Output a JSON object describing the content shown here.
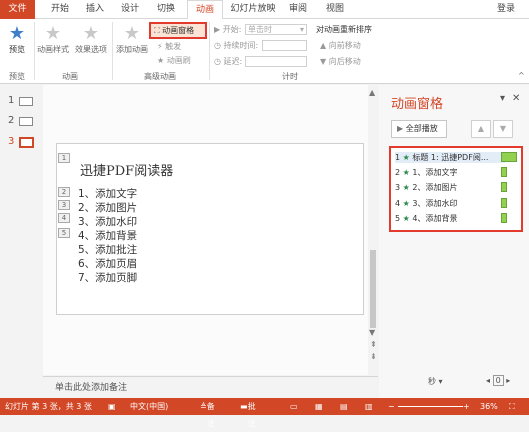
{
  "tabs": [
    {
      "label": "文件"
    },
    {
      "label": "开始"
    },
    {
      "label": "插入"
    },
    {
      "label": "设计"
    },
    {
      "label": "切换"
    },
    {
      "label": "动画"
    },
    {
      "label": "幻灯片放映"
    },
    {
      "label": "审阅"
    },
    {
      "label": "视图"
    }
  ],
  "login": "登录",
  "ribbon": {
    "preview": "预览",
    "preview_group": "预览",
    "animation_styles": "动画样式",
    "effect_options": "效果选项",
    "animation_group": "动画",
    "add_animation": "添加动画",
    "animation_pane": "动画窗格",
    "trigger": "触发",
    "animation_painter": "动画刷",
    "advanced_group": "高级动画",
    "start_label": "开始:",
    "start_value": "单击时",
    "duration_label": "持续时间:",
    "delay_label": "延迟:",
    "timing_group": "计时",
    "reorder": "对动画重新排序",
    "move_earlier": "向前移动",
    "move_later": "向后移动"
  },
  "thumbs": [
    "1",
    "2",
    "3"
  ],
  "slide": {
    "title": "迅捷PDF阅读器",
    "tags": [
      "1",
      "2",
      "3",
      "4",
      "5"
    ],
    "bullets": [
      "1、添加文字",
      "2、添加图片",
      "3、添加水印",
      "4、添加背景",
      "5、添加批注",
      "6、添加页眉",
      "7、添加页脚"
    ]
  },
  "notes_placeholder": "单击此处添加备注",
  "pane": {
    "title": "动画窗格",
    "play_all": "全部播放",
    "items": [
      {
        "num": "1",
        "label": "标题 1: 迅捷PDF阅..."
      },
      {
        "num": "2",
        "label": "1、添加文字"
      },
      {
        "num": "3",
        "label": "2、添加图片"
      },
      {
        "num": "4",
        "label": "3、添加水印"
      },
      {
        "num": "5",
        "label": "4、添加背景"
      }
    ],
    "seconds": "秒",
    "zoom_value": "0"
  },
  "status": {
    "slide_info": "幻灯片 第 3 张，共 3 张",
    "language": "中文(中国)",
    "notes": "备注",
    "comments": "批注",
    "zoom": "36%"
  }
}
